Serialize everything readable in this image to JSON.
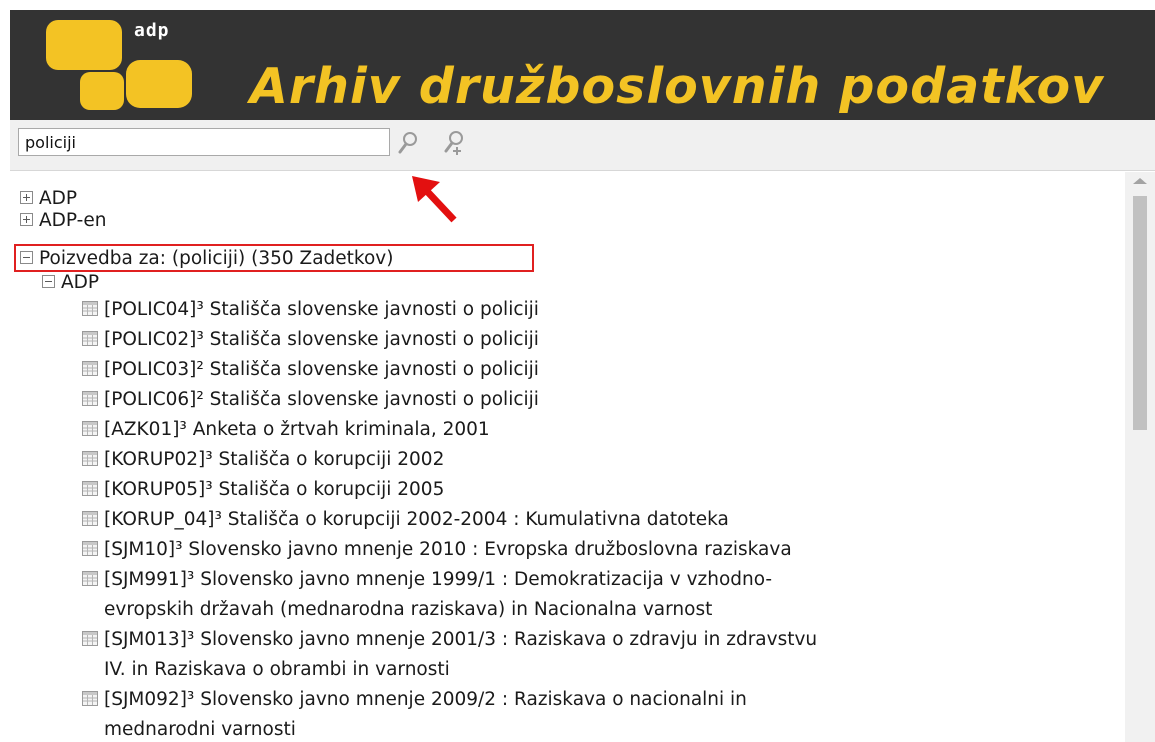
{
  "header": {
    "logo_tag": "adp",
    "title": "Arhiv družboslovnih podatkov"
  },
  "search": {
    "value": "policiji",
    "search_icon": "search-icon",
    "advanced_icon": "search-plus-icon"
  },
  "colors": {
    "header_bg": "#333333",
    "brand_yellow": "#f3c324",
    "highlight": "#e02020"
  },
  "tree": {
    "roots": [
      {
        "label": "ADP",
        "state": "collapsed"
      },
      {
        "label": "ADP-en",
        "state": "collapsed"
      },
      {
        "label": "Poizvedba za: (policiji) (350 Zadetkov)",
        "state": "expanded"
      }
    ],
    "group": {
      "label": "ADP",
      "state": "expanded"
    },
    "results": [
      {
        "lines": [
          "[POLIC04]³ Stališča slovenske javnosti o policiji"
        ]
      },
      {
        "lines": [
          "[POLIC02]³ Stališča slovenske javnosti o policiji"
        ]
      },
      {
        "lines": [
          "[POLIC03]² Stališča slovenske javnosti o policiji"
        ]
      },
      {
        "lines": [
          "[POLIC06]² Stališča slovenske javnosti o policiji"
        ]
      },
      {
        "lines": [
          "[AZK01]³ Anketa o žrtvah kriminala, 2001"
        ]
      },
      {
        "lines": [
          "[KORUP02]³ Stališča o korupciji 2002"
        ]
      },
      {
        "lines": [
          "[KORUP05]³ Stališča o korupciji 2005"
        ]
      },
      {
        "lines": [
          "[KORUP_04]³ Stališča o korupciji 2002-2004 : Kumulativna datoteka"
        ]
      },
      {
        "lines": [
          "[SJM10]³ Slovensko javno mnenje 2010 : Evropska družboslovna raziskava"
        ]
      },
      {
        "lines": [
          "[SJM991]³ Slovensko javno mnenje 1999/1 : Demokratizacija v vzhodno-",
          "evropskih državah (mednarodna raziskava) in Nacionalna varnost"
        ]
      },
      {
        "lines": [
          "[SJM013]³ Slovensko javno mnenje 2001/3 : Raziskava o zdravju in zdravstvu",
          "IV. in Raziskava o obrambi in varnosti"
        ]
      },
      {
        "lines": [
          "[SJM092]³ Slovensko javno mnenje 2009/2 : Raziskava o nacionalni in",
          "mednarodni varnosti"
        ]
      }
    ]
  }
}
